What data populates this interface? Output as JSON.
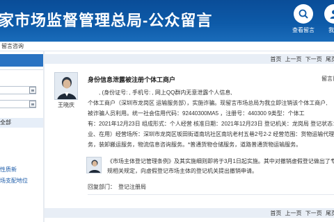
{
  "header": {
    "title": "家市场监督管理总局-公众留言",
    "buttons": [
      {
        "label": "查看留言",
        "icon": "search-icon"
      },
      {
        "label": "我要",
        "icon": "person-icon"
      }
    ],
    "colors": {
      "bar": "#0d5aa8",
      "text": "#ffffff"
    }
  },
  "breadcrumb": "留言咨询",
  "sidebar": {
    "items": [
      {
        "label": "全部"
      },
      {
        "label": "性质新"
      },
      {
        "label": "场支配地位"
      }
    ]
  },
  "pager": {
    "top": "首页 上一页 下一页 尾页",
    "bottom": "首页 上一页 下一页 尾页"
  },
  "post": {
    "author": "王晓庆",
    "title": "身份信息泄露被注册个体工商户",
    "date_label": "留言日",
    "lines": [
      "　　,  (身份证号:          ,             手机号:            ,  网上QQ群内无意泄露个人信息,",
      "个体工商户（深圳市龙岗区          运输服务部），实施诈骗。现留言市场总局为我立即注销该个体工商户,",
      "被诈骗人员利用。统一社会信用代码：92440300MA5          ，注册号：440300            9类型：个体工",
      "有：2021年12月23日 组成形式：个人经营 核准日期：2021年12月23日 登记机关：龙岗局 登记状态：",
      "业、在用）经营场所：深圳市龙岗区坂田街道南坑社区南坑老村五巷2号2-2 经营范围：货物运输代理，人",
      "务，装卸搬运服务，物流信息咨询服务。*普通货物仓储服务，道路普通货物运输服务。"
    ]
  },
  "reply": {
    "lines": [
      "《市场主体登记管理条例》及其实施细则即将于3月1日起实施。其中对撤销虚假登记做出了专门",
      "规相关规定，向虚假登记市场主体的登记机关提出撤销申请。"
    ],
    "dept_label": "回复部门：",
    "dept_value": "登记注册局"
  }
}
